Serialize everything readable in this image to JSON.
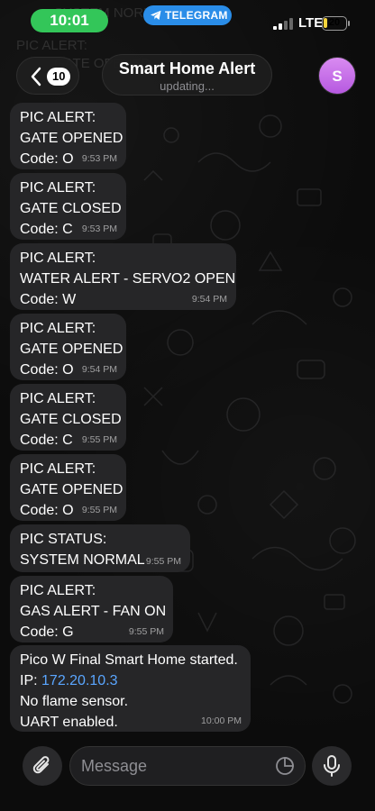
{
  "status_bar": {
    "time": "10:01",
    "app_pill": "TELEGRAM",
    "network": "LTE",
    "battery": "20",
    "battery_level": 0.2
  },
  "header": {
    "back_count": "10",
    "title": "Smart Home Alert",
    "subtitle": "updating...",
    "avatar_letter": "S"
  },
  "background_ghost": [
    "SYSTEM NORMAL",
    "PIC ALERT:",
    "GATE OPENED"
  ],
  "messages": [
    {
      "lines": [
        "PIC ALERT:",
        "GATE OPENED",
        "Code: O"
      ],
      "time": "9:53 PM"
    },
    {
      "lines": [
        "PIC ALERT:",
        "GATE CLOSED",
        "Code: C"
      ],
      "time": "9:53 PM"
    },
    {
      "lines": [
        "PIC ALERT:",
        "WATER ALERT - SERVO2 OPEN",
        "Code: W"
      ],
      "time": "9:54 PM"
    },
    {
      "lines": [
        "PIC ALERT:",
        "GATE OPENED",
        "Code: O"
      ],
      "time": "9:54 PM"
    },
    {
      "lines": [
        "PIC ALERT:",
        "GATE CLOSED",
        "Code: C"
      ],
      "time": "9:55 PM"
    },
    {
      "lines": [
        "PIC ALERT:",
        "GATE OPENED",
        "Code: O"
      ],
      "time": "9:55 PM"
    },
    {
      "lines": [
        "PIC STATUS:",
        "SYSTEM NORMAL"
      ],
      "time": "9:55 PM"
    },
    {
      "lines": [
        "PIC ALERT:",
        "GAS ALERT - FAN ON",
        "Code: G"
      ],
      "time": "9:55 PM"
    },
    {
      "line1": "Pico W Final Smart Home started.",
      "ip_label": "IP: ",
      "ip_value": "172.20.10.3",
      "line3": "No flame sensor.",
      "line4": "UART enabled.",
      "time": "10:00 PM"
    }
  ],
  "composer": {
    "placeholder": "Message"
  },
  "colors": {
    "bubble": "#262628",
    "time_pill": "#33c659",
    "telegram_pill": "#2a8de8",
    "link": "#5aa6ff",
    "avatar": "#c56ee8"
  }
}
